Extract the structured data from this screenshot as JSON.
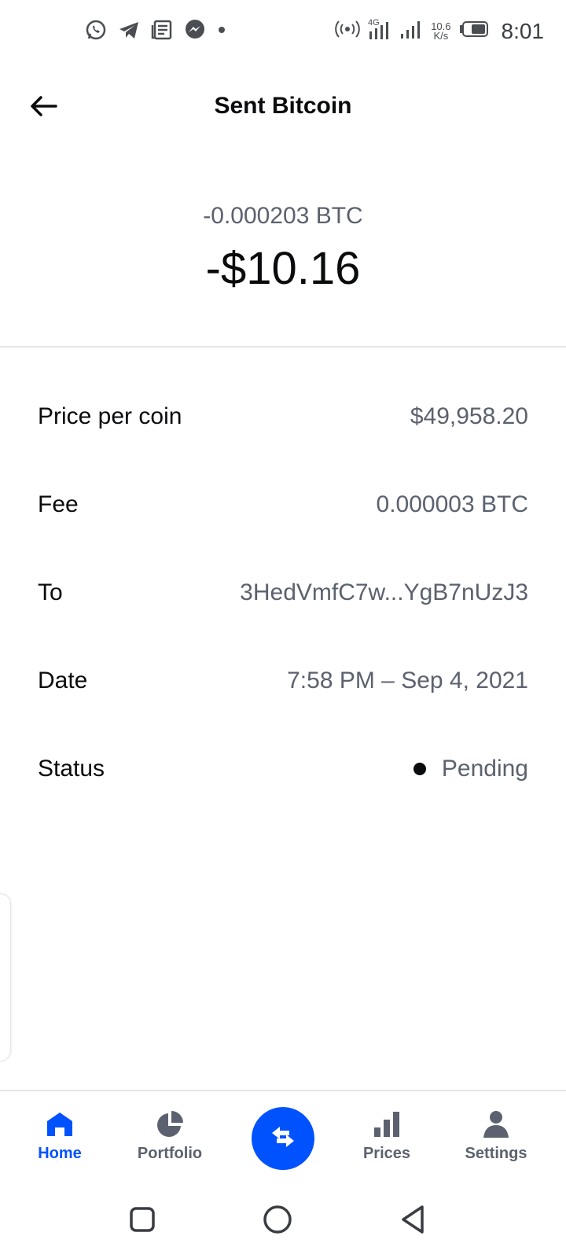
{
  "status_bar": {
    "left_icons": [
      "whatsapp-icon",
      "telegram-icon",
      "news-icon",
      "messenger-icon",
      "dot-icon"
    ],
    "network": "4G",
    "speed_value": "10.6",
    "speed_unit": "K/s",
    "time": "8:01"
  },
  "header": {
    "title": "Sent Bitcoin",
    "back_icon": "arrow-left-icon"
  },
  "amount": {
    "crypto": "-0.000203 BTC",
    "fiat": "-$10.16"
  },
  "details": [
    {
      "label": "Price per coin",
      "value": "$49,958.20"
    },
    {
      "label": "Fee",
      "value": "0.000003 BTC"
    },
    {
      "label": "To",
      "value": "3HedVmfC7w...YgB7nUzJ3"
    },
    {
      "label": "Date",
      "value": "7:58 PM – Sep 4, 2021"
    }
  ],
  "status": {
    "label": "Status",
    "value": "Pending"
  },
  "bottom_nav": {
    "items": [
      {
        "label": "Home",
        "icon": "home-icon",
        "active": true
      },
      {
        "label": "Portfolio",
        "icon": "pie-chart-icon",
        "active": false
      },
      {
        "label": "Prices",
        "icon": "bar-chart-icon",
        "active": false
      },
      {
        "label": "Settings",
        "icon": "person-icon",
        "active": false
      }
    ],
    "trade_icon": "swap-arrows-icon"
  },
  "colors": {
    "accent": "#0052ff",
    "text_primary": "#0a0b0d",
    "text_secondary": "#5b616e",
    "divider": "#e3e5e8"
  }
}
